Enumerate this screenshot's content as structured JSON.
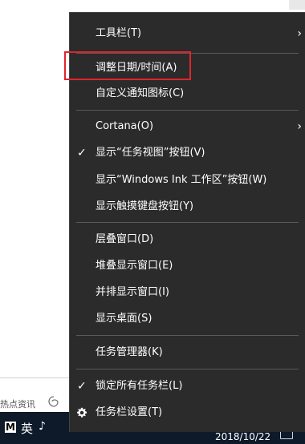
{
  "background": {
    "hot_news": "热点资讯"
  },
  "taskbar": {
    "app_label": "M",
    "ime_label": "英",
    "ime_mode_glyph": "♪",
    "date": "2018/10/22"
  },
  "menu": {
    "items": [
      {
        "label": "工具栏(T)",
        "submenu": true
      },
      {
        "label": "调整日期/时间(A)",
        "highlighted": true
      },
      {
        "label": "自定义通知图标(C)"
      },
      {
        "label": "Cortana(O)",
        "submenu": true
      },
      {
        "label": "显示“任务视图”按钮(V)",
        "checked": true
      },
      {
        "label": "显示“Windows Ink 工作区”按钮(W)"
      },
      {
        "label": "显示触摸键盘按钮(Y)"
      },
      {
        "label": "层叠窗口(D)"
      },
      {
        "label": "堆叠显示窗口(E)"
      },
      {
        "label": "并排显示窗口(I)"
      },
      {
        "label": "显示桌面(S)"
      },
      {
        "label": "任务管理器(K)"
      },
      {
        "label": "锁定所有任务栏(L)",
        "checked": true
      },
      {
        "label": "任务栏设置(T)",
        "icon": "gear-icon"
      }
    ],
    "arrow_glyph": "›",
    "check_glyph": "✓"
  },
  "colors": {
    "menu_bg": "#2b2b2b",
    "menu_text": "#ffffff",
    "separator": "#5a5a5a",
    "highlight_box": "#e0242e",
    "taskbar_bg": "#0e1a2a"
  }
}
